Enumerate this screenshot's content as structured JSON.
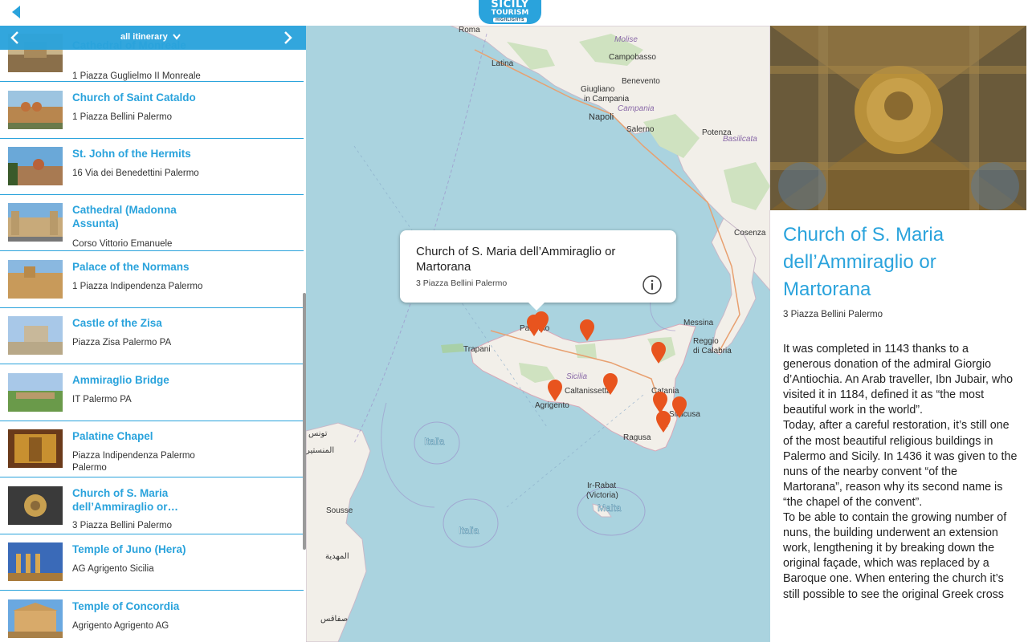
{
  "header": {
    "logo_line1": "SICILY",
    "logo_line2": "TOURISM",
    "logo_line3": "HIGHLIGHTS"
  },
  "itinerary": {
    "label": "all itinerary"
  },
  "list": [
    {
      "name": "Cathedral of Monreale",
      "address": "1 Piazza Guglielmo II Monreale"
    },
    {
      "name": "Church of Saint Cataldo",
      "address": "1 Piazza Bellini Palermo"
    },
    {
      "name": "St. John of the Hermits",
      "address": "16 Via dei Benedettini Palermo"
    },
    {
      "name": "Cathedral (Madonna Assunta)",
      "address": "Corso Vittorio Emanuele"
    },
    {
      "name": "Palace of the Normans",
      "address": "1 Piazza Indipendenza Palermo"
    },
    {
      "name": "Castle of the Zisa",
      "address": "Piazza Zisa Palermo PA"
    },
    {
      "name": "Ammiraglio Bridge",
      "address": "IT Palermo PA"
    },
    {
      "name": "Palatine Chapel",
      "address": "Piazza Indipendenza Palermo Palermo"
    },
    {
      "name": "Church of S. Maria dell’Ammiraglio or…",
      "address": "3 Piazza Bellini Palermo"
    },
    {
      "name": "Temple of Juno (Hera)",
      "address": "AG Agrigento Sicilia"
    },
    {
      "name": "Temple of Concordia",
      "address": "Agrigento Agrigento AG"
    }
  ],
  "map": {
    "labels": {
      "roma": "Roma",
      "molise": "Molise",
      "latina": "Latina",
      "campobasso": "Campobasso",
      "benevento": "Benevento",
      "giugliano": "Giugliano",
      "in_campania": "in Campania",
      "campania": "Campania",
      "napoli": "Napoli",
      "salerno": "Salerno",
      "potenza": "Potenza",
      "basilicata": "Basilicata",
      "cosenza": "Cosenza",
      "messina": "Messina",
      "reggio": "Reggio",
      "di_calabria": "di Calabria",
      "trapani": "Trapani",
      "palermo": "Palermo",
      "sicilia": "Sicilia",
      "caltanissetta": "Caltanissetta",
      "catania": "Catania",
      "agrigento": "Agrigento",
      "siracusa": "Siracusa",
      "ragusa": "Ragusa",
      "italia1": "Italia",
      "italia2": "Italia",
      "malta": "Malta",
      "ir_rabat": "Ir-Rabat",
      "victoria": "(Victoria)",
      "sousse": "Sousse",
      "tunis": "تونس",
      "mahdia": "المهدية",
      "sfax": "صفاقس",
      "monastir": "المنستير"
    },
    "popup": {
      "title": "Church of S. Maria dell’Ammiraglio or Martorana",
      "address": "3 Piazza Bellini Palermo"
    }
  },
  "detail": {
    "title": "Church of S. Maria dell’Ammiraglio or Martorana",
    "address": "3 Piazza Bellini Palermo",
    "paragraphs": [
      "It was completed in 1143 thanks to a generous donation of the admiral Giorgio d’Antiochia. An Arab traveller, Ibn Jubair, who visited it in 1184, defined it as “the most beautiful work in the world”.",
      "Today, after a careful restoration, it’s still one of the most beautiful religious buildings in Palermo and Sicily. In 1436 it was given to the nuns of the nearby convent “of the Martorana”, reason why its second name is “the chapel of the convent”.",
      "To be able to contain the growing number of nuns, the building underwent an extension work, lengthening it by breaking down the original façade, which was replaced by a Baroque one. When entering the church it’s still possible to see the original Greek cross"
    ]
  },
  "colors": {
    "accent": "#2aa3dc",
    "pin": "#e8541e",
    "sea": "#aad3df",
    "land": "#f2efe9"
  }
}
